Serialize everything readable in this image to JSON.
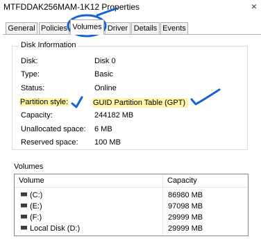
{
  "window": {
    "title": "MTFDDAK256MAM-1K12 Properties",
    "close_label": "×"
  },
  "tabs": [
    {
      "label": "General"
    },
    {
      "label": "Policies"
    },
    {
      "label": "Volumes"
    },
    {
      "label": "Driver"
    },
    {
      "label": "Details"
    },
    {
      "label": "Events"
    }
  ],
  "active_tab": "Volumes",
  "disk_info": {
    "group_label": "Disk Information",
    "rows": [
      {
        "label": "Disk:",
        "value": "Disk 0"
      },
      {
        "label": "Type:",
        "value": "Basic"
      },
      {
        "label": "Status:",
        "value": "Online"
      },
      {
        "label": "Partition style:",
        "value": "GUID Partition Table (GPT)"
      },
      {
        "label": "Capacity:",
        "value": "244182 MB"
      },
      {
        "label": "Unallocated space:",
        "value": "6 MB"
      },
      {
        "label": "Reserved space:",
        "value": "100 MB"
      }
    ]
  },
  "volumes": {
    "title": "Volumes",
    "columns": [
      "Volume",
      "Capacity"
    ],
    "rows": [
      {
        "volume": "(C:)",
        "capacity": "86980 MB"
      },
      {
        "volume": "(E:)",
        "capacity": "97098 MB"
      },
      {
        "volume": "(F:)",
        "capacity": "29999 MB"
      },
      {
        "volume": "Local Disk (D:)",
        "capacity": "29999 MB"
      }
    ]
  },
  "colors": {
    "highlight": "#fff3a8",
    "annotation_ink": "#1462d6"
  }
}
